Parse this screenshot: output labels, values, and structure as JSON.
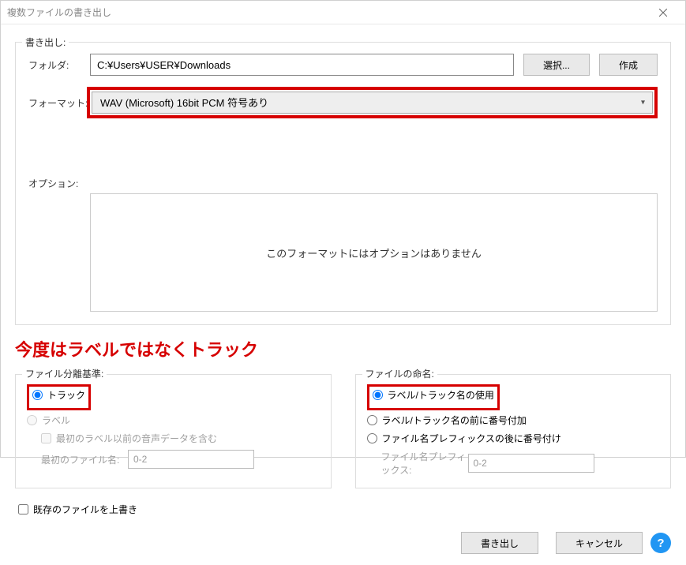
{
  "title": "複数ファイルの書き出し",
  "export": {
    "legend": "書き出し:",
    "folder_label": "フォルダ:",
    "folder_value": "C:¥Users¥USER¥Downloads",
    "select_btn": "選択...",
    "create_btn": "作成",
    "format_label": "フォーマット:",
    "format_value": "WAV (Microsoft) 16bit PCM 符号あり",
    "option_label": "オプション:",
    "option_text": "このフォーマットにはオプションはありません"
  },
  "annotation": "今度はラベルではなくトラック",
  "split": {
    "legend": "ファイル分離基準:",
    "radio_track": "トラック",
    "radio_label": "ラベル",
    "check_include": "最初のラベル以前の音声データを含む",
    "first_file_label": "最初のファイル名:",
    "first_file_value": "0-2"
  },
  "naming": {
    "legend": "ファイルの命名:",
    "radio_use": "ラベル/トラック名の使用",
    "radio_before": "ラベル/トラック名の前に番号付加",
    "radio_after": "ファイル名プレフィックスの後に番号付け",
    "prefix_label": "ファイル名プレフィックス:",
    "prefix_value": "0-2"
  },
  "overwrite": "既存のファイルを上書き",
  "actions": {
    "export": "書き出し",
    "cancel": "キャンセル",
    "help": "?"
  }
}
